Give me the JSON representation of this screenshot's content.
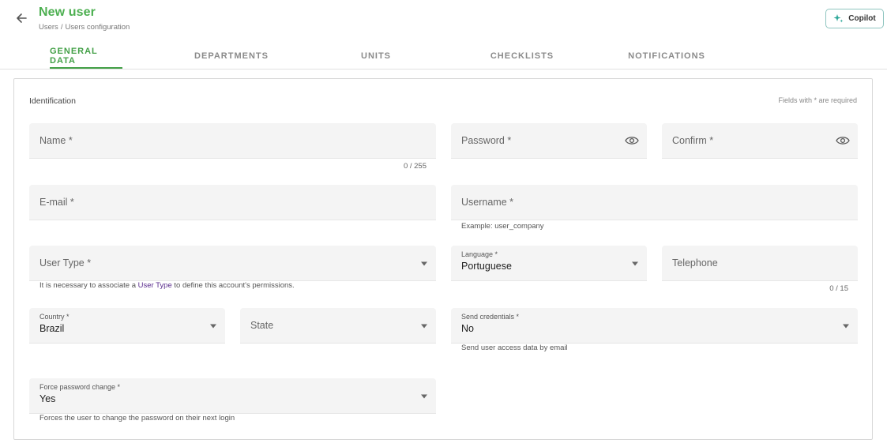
{
  "header": {
    "title": "New user",
    "breadcrumb": {
      "parent": "Users",
      "separator": "/",
      "current": "Users configuration"
    },
    "copilot_label": "Copilot"
  },
  "tabs": [
    {
      "label": "GENERAL DATA",
      "active": true
    },
    {
      "label": "DEPARTMENTS",
      "active": false
    },
    {
      "label": "UNITS",
      "active": false
    },
    {
      "label": "CHECKLISTS",
      "active": false
    },
    {
      "label": "NOTIFICATIONS",
      "active": false
    }
  ],
  "form": {
    "section_title": "Identification",
    "required_note": "Fields with * are required",
    "name": {
      "placeholder": "Name *",
      "counter": "0 / 255"
    },
    "password": {
      "placeholder": "Password *"
    },
    "confirm": {
      "placeholder": "Confirm *"
    },
    "email": {
      "placeholder": "E-mail *"
    },
    "username": {
      "placeholder": "Username *",
      "hint": "Example: user_company"
    },
    "user_type": {
      "placeholder": "User Type *",
      "hint_before": "It is necessary to associate a ",
      "hint_link": "User Type",
      "hint_after": " to define this account's permissions."
    },
    "language": {
      "label": "Language *",
      "value": "Portuguese"
    },
    "telephone": {
      "placeholder": "Telephone",
      "counter": "0 / 15"
    },
    "country": {
      "label": "Country *",
      "value": "Brazil"
    },
    "state": {
      "placeholder": "State"
    },
    "send_credentials": {
      "label": "Send credentials *",
      "value": "No",
      "hint": "Send user access data by email"
    },
    "force_password_change": {
      "label": "Force password change *",
      "value": "Yes",
      "hint": "Forces the user to change the password on their next login"
    }
  },
  "colors": {
    "accent": "#43a047",
    "title": "#4caf50",
    "link": "#5b2d8e",
    "field_bg": "#f4f4f4"
  },
  "icons": [
    "arrow-left-icon",
    "sparkle-icon",
    "eye-icon",
    "caret-down-icon"
  ]
}
